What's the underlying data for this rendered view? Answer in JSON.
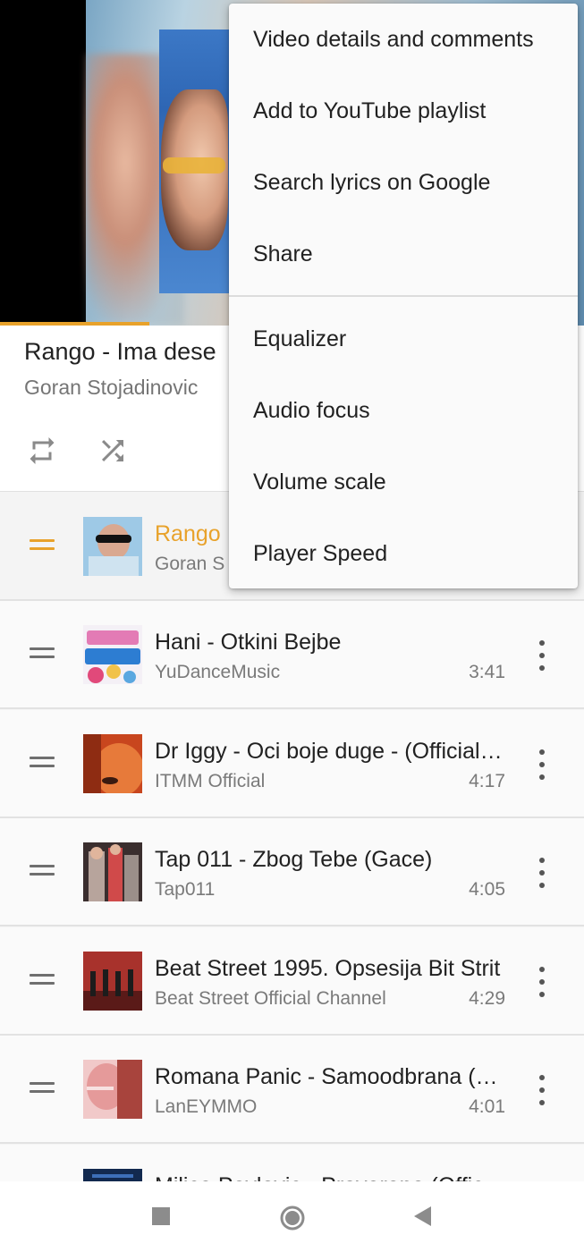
{
  "now_playing": {
    "title": "Rango - Ima dese",
    "artist": "Goran Stojadinovic",
    "progress_fraction": 0.255
  },
  "controls": {
    "repeat_icon": "repeat-icon",
    "shuffle_icon": "shuffle-icon"
  },
  "menu": {
    "items": [
      "Video details and comments",
      "Add to YouTube playlist",
      "Search lyrics on Google",
      "Share",
      "Equalizer",
      "Audio focus",
      "Volume scale",
      "Player Speed"
    ]
  },
  "playlist": [
    {
      "title": "Rango",
      "artist": "Goran S",
      "duration": "",
      "active": true
    },
    {
      "title": "Hani - Otkini Bejbe",
      "artist": "YuDanceMusic",
      "duration": "3:41"
    },
    {
      "title": "Dr Iggy - Oci boje duge - (Official Video)",
      "artist": "ITMM Official",
      "duration": "4:17"
    },
    {
      "title": "Tap 011 - Zbog Tebe (Gace)",
      "artist": "Tap011",
      "duration": "4:05"
    },
    {
      "title": "Beat Street 1995. Opsesija Bit Strit",
      "artist": "Beat Street Official Channel",
      "duration": "4:29"
    },
    {
      "title": "Romana Panic - Samoodbrana (Official)",
      "artist": "LanEYMMO",
      "duration": "4:01"
    },
    {
      "title": "Milica Pavlovic - Provereno (Official)",
      "artist": "",
      "duration": ""
    }
  ],
  "colors": {
    "accent": "#e8a22b"
  },
  "navbar": {
    "recents_icon": "square-icon",
    "home_icon": "circle-icon",
    "back_icon": "triangle-back-icon"
  }
}
